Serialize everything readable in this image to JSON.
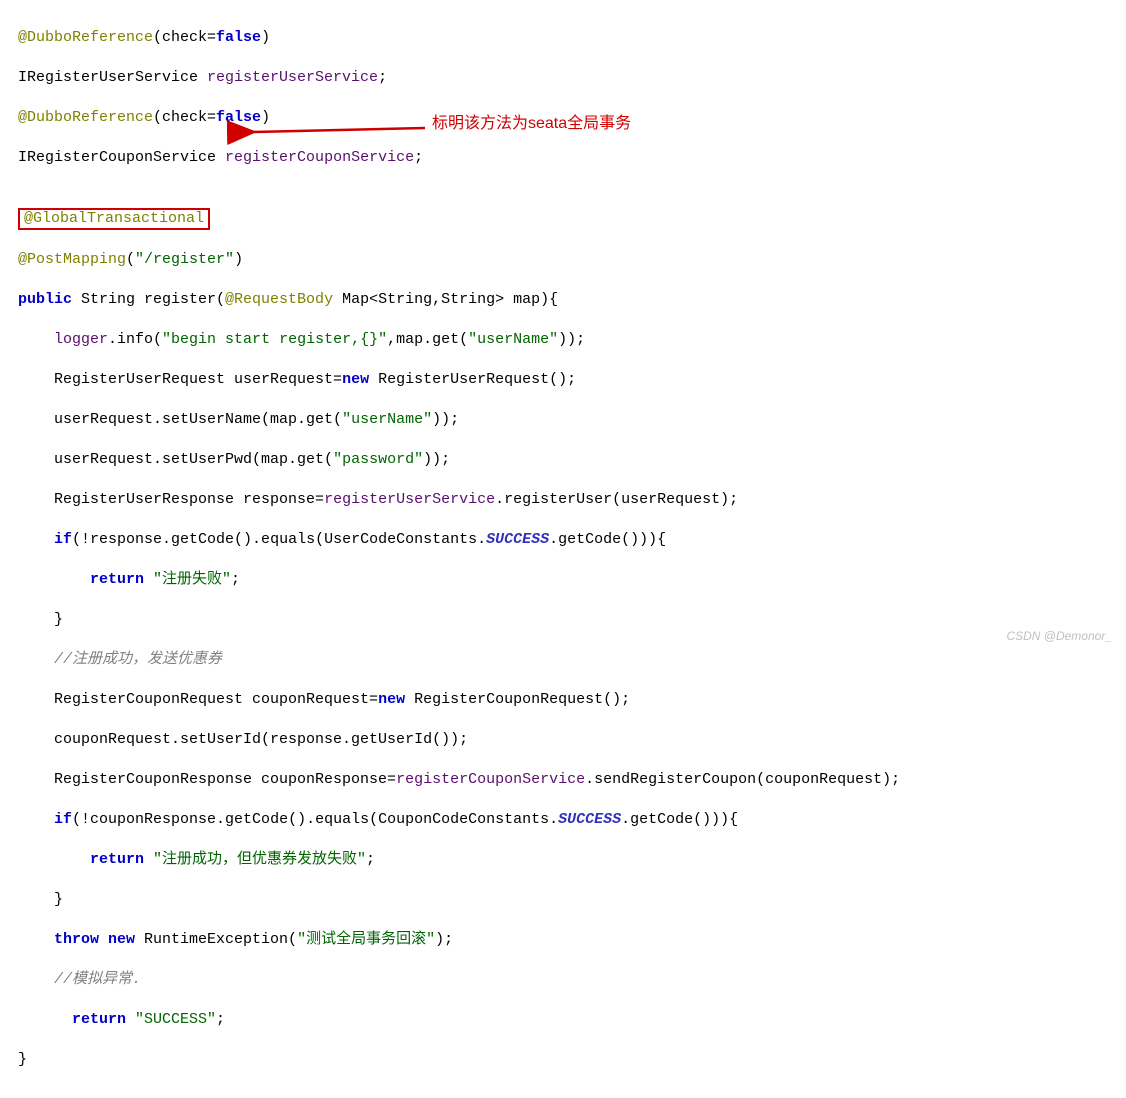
{
  "code": {
    "l1a": "@DubboReference",
    "l1b": "(check=",
    "l1c": "false",
    "l1d": ")",
    "l2a": "IRegisterUserService ",
    "l2b": "registerUserService",
    "l2c": ";",
    "l3a": "@DubboReference",
    "l3b": "(check=",
    "l3c": "false",
    "l3d": ")",
    "l4a": "IRegisterCouponService ",
    "l4b": "registerCouponService",
    "l4c": ";",
    "l5": "",
    "l6a": "@GlobalTransactional",
    "l7a": "@PostMapping",
    "l7b": "(",
    "l7c": "\"/register\"",
    "l7d": ")",
    "l8a": "public",
    "l8b": " String register(",
    "l8c": "@RequestBody",
    "l8d": " Map<String,String> map){",
    "l9a": "    ",
    "l9b": "logger",
    "l9c": ".info(",
    "l9d": "\"begin start register,{}\"",
    "l9e": ",map.get(",
    "l9f": "\"userName\"",
    "l9g": "));",
    "l10": "    RegisterUserRequest userRequest=",
    "l10b": "new",
    "l10c": " RegisterUserRequest();",
    "l11a": "    userRequest.setUserName(map.get(",
    "l11b": "\"userName\"",
    "l11c": "));",
    "l12a": "    userRequest.setUserPwd(map.get(",
    "l12b": "\"password\"",
    "l12c": "));",
    "l13a": "    RegisterUserResponse response=",
    "l13b": "registerUserService",
    "l13c": ".registerUser(userRequest);",
    "l14a": "    ",
    "l14b": "if",
    "l14c": "(!response.getCode().equals(UserCodeConstants.",
    "l14d": "SUCCESS",
    "l14e": ".getCode())){",
    "l15a": "        ",
    "l15b": "return ",
    "l15c": "\"注册失败\"",
    "l15d": ";",
    "l16": "    }",
    "l17a": "    ",
    "l17b": "//注册成功，发送优惠券",
    "l18a": "    RegisterCouponRequest couponRequest=",
    "l18b": "new",
    "l18c": " RegisterCouponRequest();",
    "l19": "    couponRequest.setUserId(response.getUserId());",
    "l20a": "    RegisterCouponResponse couponResponse=",
    "l20b": "registerCouponService",
    "l20c": ".sendRegisterCoupon(couponRequest);",
    "l21a": "    ",
    "l21b": "if",
    "l21c": "(!couponResponse.getCode().equals(CouponCodeConstants.",
    "l21d": "SUCCESS",
    "l21e": ".getCode())){",
    "l22a": "        ",
    "l22b": "return ",
    "l22c": "\"注册成功，但优惠券发放失败\"",
    "l22d": ";",
    "l23": "    }",
    "l24a": "    ",
    "l24b": "throw new",
    "l24c": " RuntimeException(",
    "l24d": "\"测试全局事务回滚\"",
    "l24e": ");",
    "l25a": "    ",
    "l25b": "//模拟异常.",
    "l26a": "      ",
    "l26b": "return ",
    "l26c": "\"SUCCESS\"",
    "l26d": ";",
    "l27": "}"
  },
  "annotation": "标明该方法为seata全局事务",
  "watermark": "CSDN @Demonor_"
}
